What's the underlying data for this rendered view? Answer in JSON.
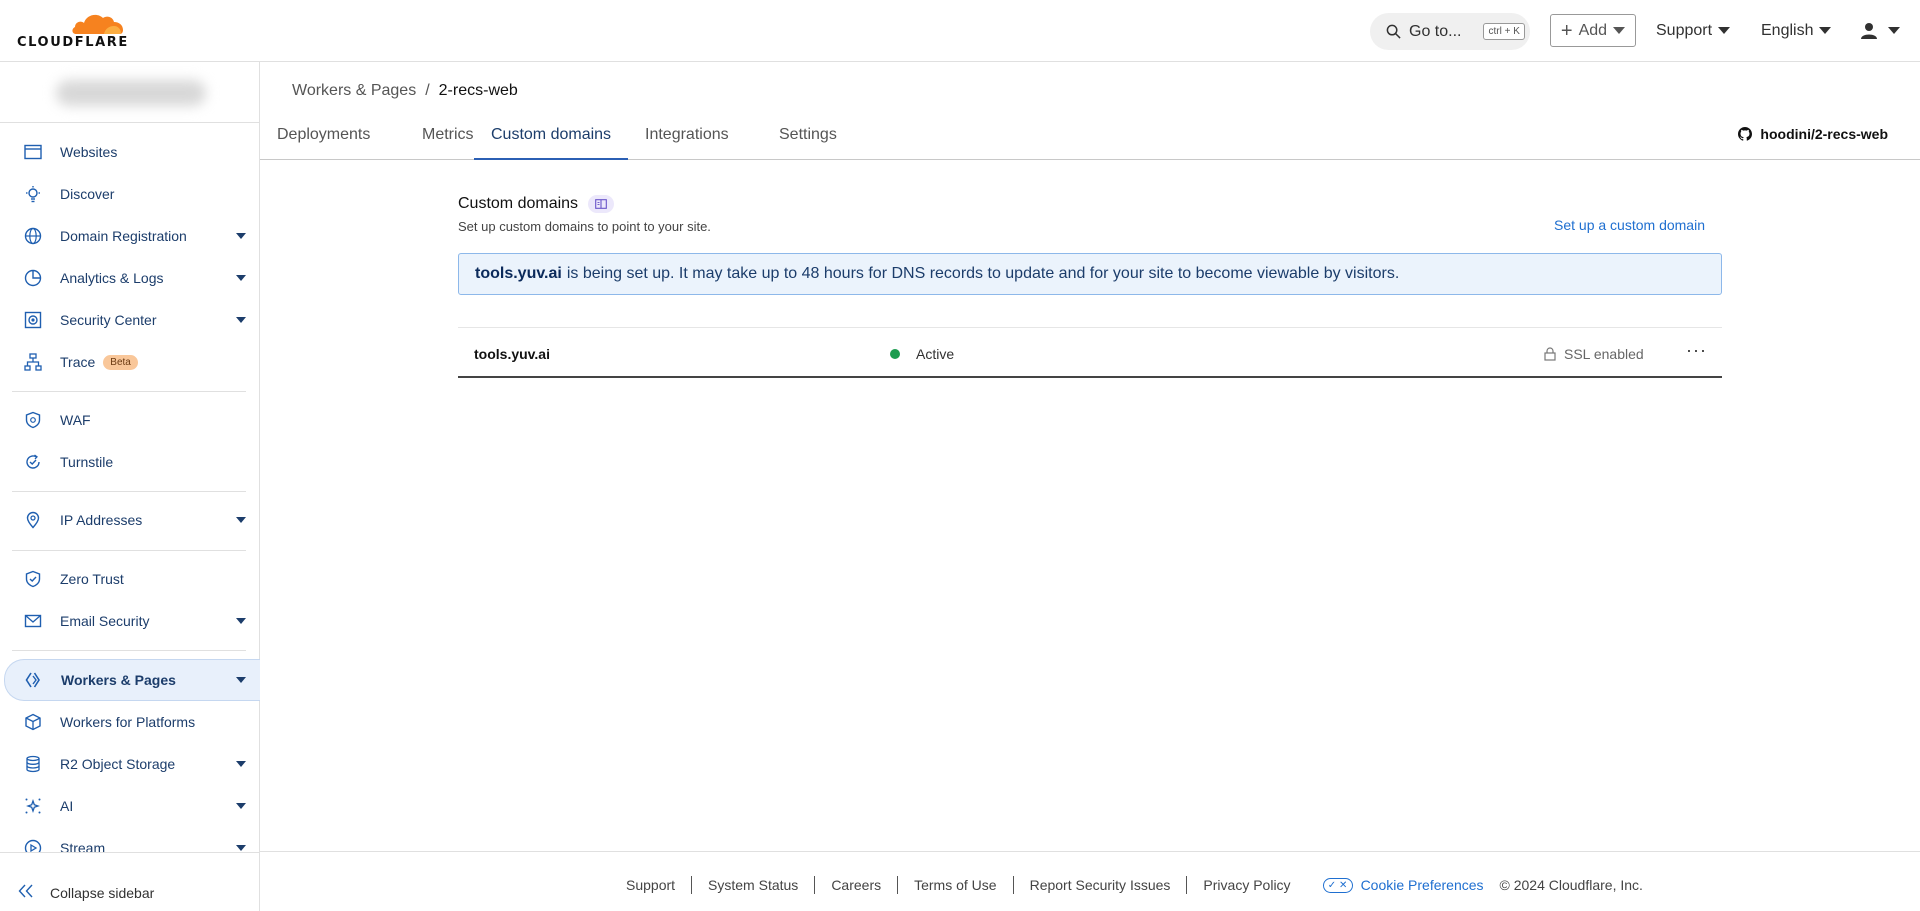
{
  "header": {
    "logo_text": "CLOUDFLARE",
    "search_label": "Go to...",
    "search_shortcut": "ctrl + K",
    "add_label": "Add",
    "support_label": "Support",
    "language_label": "English"
  },
  "sidebar": {
    "items": [
      {
        "label": "Websites"
      },
      {
        "label": "Discover"
      },
      {
        "label": "Domain Registration"
      },
      {
        "label": "Analytics & Logs"
      },
      {
        "label": "Security Center"
      },
      {
        "label": "Trace",
        "badge": "Beta"
      },
      {
        "label": "WAF"
      },
      {
        "label": "Turnstile"
      },
      {
        "label": "IP Addresses"
      },
      {
        "label": "Zero Trust"
      },
      {
        "label": "Email Security"
      },
      {
        "label": "Workers & Pages"
      },
      {
        "label": "Workers for Platforms"
      },
      {
        "label": "R2 Object Storage"
      },
      {
        "label": "AI"
      },
      {
        "label": "Stream"
      }
    ],
    "collapse_label": "Collapse sidebar"
  },
  "breadcrumb": {
    "parent": "Workers & Pages",
    "separator": "/",
    "current": "2-recs-web"
  },
  "tabs": [
    {
      "label": "Deployments"
    },
    {
      "label": "Metrics"
    },
    {
      "label": "Custom domains"
    },
    {
      "label": "Integrations"
    },
    {
      "label": "Settings"
    }
  ],
  "repo": "hoodini/2-recs-web",
  "main": {
    "title": "Custom domains",
    "subtitle": "Set up custom domains to point to your site.",
    "setup_link": "Set up a custom domain",
    "banner_domain": "tools.yuv.ai",
    "banner_text": "is being set up. It may take up to 48 hours for DNS records to update and for your site to become viewable by visitors.",
    "row": {
      "domain": "tools.yuv.ai",
      "status": "Active",
      "ssl": "SSL enabled",
      "more": "···"
    }
  },
  "footer": {
    "links": [
      "Support",
      "System Status",
      "Careers",
      "Terms of Use",
      "Report Security Issues",
      "Privacy Policy"
    ],
    "cookie": "Cookie Preferences",
    "copyright": "© 2024 Cloudflare, Inc."
  },
  "colors": {
    "accent": "#2b5fb4",
    "brand_orange": "#f6821f",
    "status_active": "#1c9c4f",
    "link": "#1f6fd0"
  }
}
